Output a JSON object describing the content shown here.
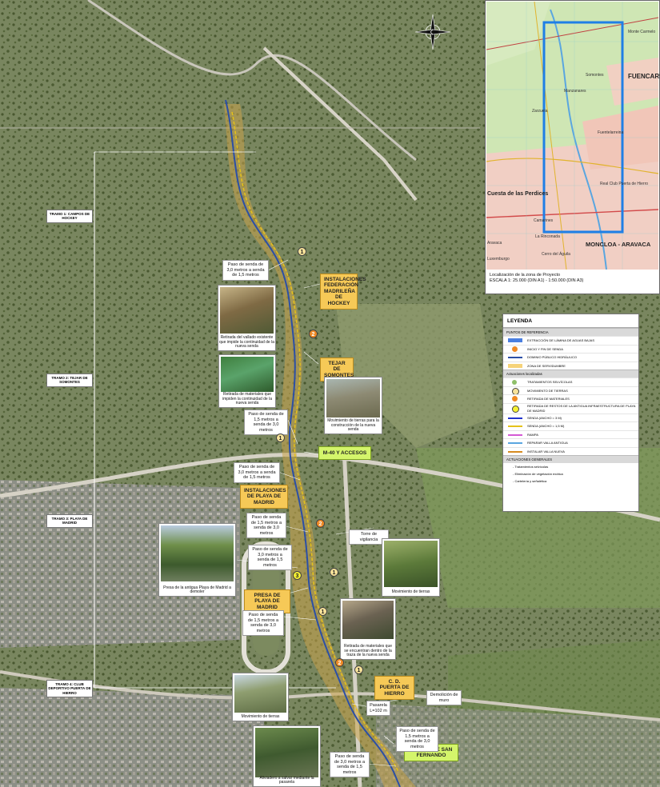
{
  "compass": {
    "icon": "north-arrow-icon"
  },
  "tramos": [
    {
      "text": "TRAMO 1: CAMPOS DE HOCKEY"
    },
    {
      "text": "TRAMO 2: TEJAR DE SOMONTES"
    },
    {
      "text": "TRAMO 3: PLAYA DE MADRID"
    },
    {
      "text": "TRAMO 4: CLUB DEPORTIVO PUERTA DE HIERRO"
    }
  ],
  "places": {
    "hockey": "INSTALACIONES FEDERACIÓN MADRILEÑA DE HOCKEY",
    "tejar": "TEJAR DE SOMONTES",
    "m40": "M-40 Y ACCESOS",
    "playa": "INSTALACIONES DE PLAYA DE MADRID",
    "presa": "PRESA DE PLAYA DE MADRID",
    "cd": "C. D. PUERTA DE HIERRO",
    "sanfernando": "PUENTE DE SAN FERNANDO"
  },
  "callouts": {
    "c1": "Paso de senda de 3,0 metros a senda de 1,5 metros",
    "c2": "Paso de senda de 1,5 metros a senda de 3,0 metros",
    "c3": "Paso de senda de 3,0 metros a senda de 1,5 metros",
    "c4": "Paso de senda de 1,5 metros a senda de 3,0 metros",
    "c5": "Paso de senda de 3,0 metros a senda de 1,5 metros",
    "c6": "Paso de senda de 1,5 metros a senda de 3,0 metros",
    "c7": "Paso de senda de 1,5 metros a senda de 3,0 metros",
    "c8": "Paso de senda de 3,0 metros a senda de 1,5 metros",
    "torre": "Torre de vigilancia",
    "pasarela": "Pasarela L=102 m",
    "demolicion": "Demolición de muro"
  },
  "photos": {
    "p1": "Retirada del vallado existente que impide la continuidad de la nueva senda",
    "p2": "Retirada de materiales que impiden la continuidad de la nueva senda",
    "p3": "Movimiento de tierras para la construcción de la nueva senda",
    "p4": "Presa de la antigua Playa de Madrid a demoler",
    "p5": "Movimiento de tierras",
    "p6": "Retirada de materiales que se encuentran dentro de la traza de la nueva senda",
    "p7": "Movimiento de tierras",
    "p8": "Aliviadero a salvar mediante la pasarela"
  },
  "numbers": [
    "1",
    "2",
    "1",
    "2",
    "3",
    "1",
    "1",
    "2",
    "1"
  ],
  "inset": {
    "places": [
      "FUENCARRAL",
      "Monte Carmelo",
      "Fuentelarreina",
      "Somontes",
      "Cuesta de las Perdices",
      "Aravaca",
      "Camarines",
      "La Rinconada",
      "MONCLOA - ARAVACA",
      "Cerro del Águila",
      "Luxemburgo",
      "Real Club Puerta de Hierro",
      "Manzanares",
      "Zarzuela"
    ],
    "caption_line1": "Localización de la zona de Proyecto",
    "caption_line2": "ESCALA 1: 25.000 (DIN A1) - 1:50.000 (DIN A3)"
  },
  "legend": {
    "title": "LEYENDA",
    "sec_ref": "PUNTOS DE REFERENCIA",
    "sec_loc": "Actuaciones localizadas",
    "sec_gen": "ACTUACIONES GENERALES",
    "ref_items": [
      {
        "label": "EXTRACCIÓN DE LÁMINA DE AGUAS BAJAS",
        "color": "#4a7fe0"
      },
      {
        "label": "INICIO Y FIN DE SENDA",
        "color": "#f08a24"
      },
      {
        "label": "DOMINIO PÚBLICO HIDRÁULICO",
        "color": "#2b4fa6"
      },
      {
        "label": "ZONA DE SERVIDUMBRE",
        "color": "#f6d37a"
      }
    ],
    "loc_items": [
      {
        "label": "TRATAMIENTOS SELVÍCOLAS",
        "num": ""
      },
      {
        "label": "MOVIMIENTO DE TIERRAS",
        "num": "1"
      },
      {
        "label": "RETIRADA DE MATERIALES",
        "num": "2"
      },
      {
        "label": "RETIRADA DE RESTOS DE LA ANTIGUA INFRAESTRUCTURA DE PLAYA DE MADRID",
        "num": "3"
      },
      {
        "label": "SENDA (ANCHO = 3 M)",
        "color": "#2233cc"
      },
      {
        "label": "SENDA (ANCHO = 1,5 M)",
        "color": "#e5c21a"
      },
      {
        "label": "RAMPA",
        "color": "#d45ad4"
      },
      {
        "label": "REPARAR VALLA ANTIGUA",
        "color": "#5aa6e0"
      },
      {
        "label": "INSTALAR VALLA NUEVA",
        "color": "#d68b1f"
      }
    ],
    "gen_items": [
      "- Tratamientos selvícolas",
      "- Eliminación de vegetación exótica",
      "- Cartelería y señalética"
    ]
  }
}
